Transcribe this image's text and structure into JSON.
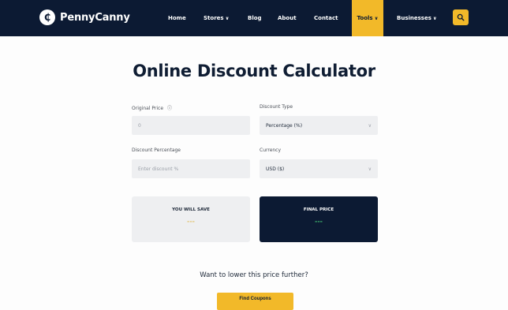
{
  "nav": {
    "logo_glyph": "₵",
    "brand": "PennyCanny",
    "items": [
      {
        "label": "Home"
      },
      {
        "label": "Stores"
      },
      {
        "label": "Blog"
      },
      {
        "label": "About"
      },
      {
        "label": "Contact"
      },
      {
        "label": "Tools"
      },
      {
        "label": "Businesses"
      }
    ],
    "active_item": "Tools",
    "dropdown_glyph": "∨",
    "search_icon": "search-icon"
  },
  "page": {
    "title": "Online Discount Calculator"
  },
  "form": {
    "original_price": {
      "label": "Original Price",
      "info_glyph": "ⓘ",
      "value": "0"
    },
    "discount_type": {
      "label": "Discount Type",
      "value": "Percentage (%)"
    },
    "discount_percentage": {
      "label": "Discount Percentage",
      "placeholder": "Enter discount %"
    },
    "currency": {
      "label": "Currency",
      "value": "USD ($)"
    },
    "select_glyph": "∨"
  },
  "results": {
    "you_will_save": {
      "label": "YOU WILL SAVE",
      "value": "---"
    },
    "final_price": {
      "label": "FINAL PRICE",
      "value": "---"
    }
  },
  "cta": {
    "question": "Want to lower this price further?",
    "button": "Find Coupons"
  },
  "colors": {
    "navy": "#0c1a33",
    "accent_yellow": "#f2b929",
    "field_gray": "#eeeff1",
    "save_value": "#e3c470",
    "final_value": "#3fb56e"
  }
}
